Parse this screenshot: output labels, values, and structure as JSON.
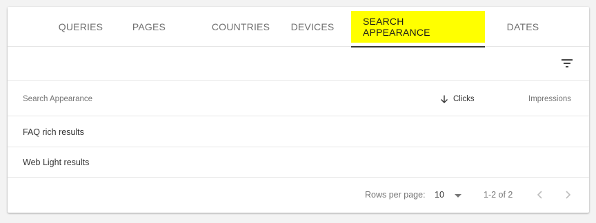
{
  "tabs": [
    {
      "label": "QUERIES",
      "active": false
    },
    {
      "label": "PAGES",
      "active": false
    },
    {
      "label": "COUNTRIES",
      "active": false
    },
    {
      "label": "DEVICES",
      "active": false
    },
    {
      "label": "SEARCH APPEARANCE",
      "active": true
    },
    {
      "label": "DATES",
      "active": false
    }
  ],
  "toolbar": {
    "filter_icon": "filter-icon"
  },
  "table": {
    "columns": {
      "name": "Search Appearance",
      "clicks": "Clicks",
      "impressions": "Impressions"
    },
    "sort_icon": "arrow-down-icon",
    "rows": [
      {
        "name": "FAQ rich results"
      },
      {
        "name": "Web Light results"
      }
    ]
  },
  "pagination": {
    "rows_per_page_label": "Rows per page:",
    "rows_per_page_value": "10",
    "range": "1-2 of 2"
  },
  "colors": {
    "active_tab_highlight": "#ffff00",
    "active_tab_underline": "#333333",
    "divider": "#e6e6e6"
  }
}
